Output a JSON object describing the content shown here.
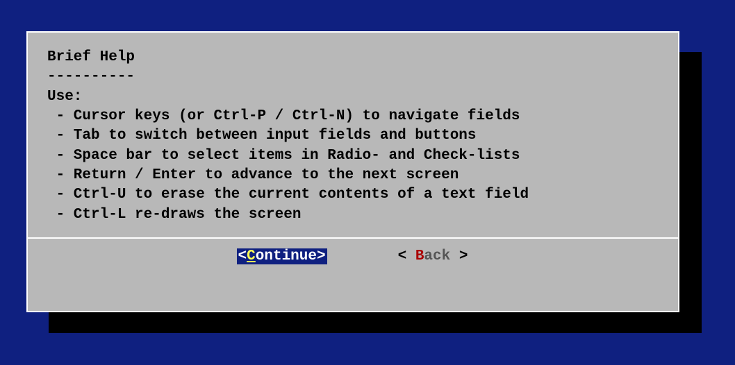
{
  "dialog": {
    "title": "Brief Help",
    "underline": "----------",
    "intro": "Use:",
    "items": [
      " - Cursor keys (or Ctrl-P / Ctrl-N) to navigate fields",
      " - Tab to switch between input fields and buttons",
      " - Space bar to select items in Radio- and Check-lists",
      " - Return / Enter to advance to the next screen",
      " - Ctrl-U to erase the current contents of a text field",
      " - Ctrl-L re-draws the screen"
    ]
  },
  "buttons": {
    "continue": {
      "open": "<",
      "hotkey": "C",
      "rest": "ontinue",
      "close": ">"
    },
    "back": {
      "open": "<",
      "hotkey": "B",
      "rest": "ack",
      "close": ">"
    }
  }
}
